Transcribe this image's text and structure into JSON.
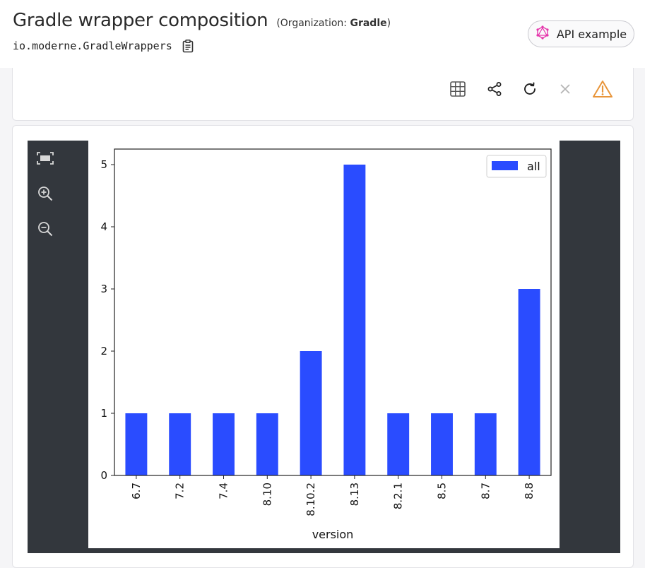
{
  "header": {
    "title": "Gradle wrapper composition",
    "org_prefix": "(Organization: ",
    "org_name": "Gradle",
    "org_suffix": ")",
    "recipe_id": "io.moderne.GradleWrappers",
    "api_button_label": "API example"
  },
  "toolbar": {
    "icons": [
      "table-icon",
      "share-icon",
      "refresh-icon",
      "close-icon",
      "warning-icon"
    ],
    "warning_color": "#e8953a"
  },
  "viewer": {
    "tools": [
      "fit-screen-icon",
      "zoom-in-icon",
      "zoom-out-icon"
    ],
    "background": "#33373d"
  },
  "chart_data": {
    "type": "bar",
    "categories": [
      "6.7",
      "7.2",
      "7.4",
      "8.10",
      "8.10.2",
      "8.13",
      "8.2.1",
      "8.5",
      "8.7",
      "8.8"
    ],
    "series": [
      {
        "name": "all",
        "values": [
          1,
          1,
          1,
          1,
          2,
          5,
          1,
          1,
          1,
          3
        ],
        "color": "#2a4cff"
      }
    ],
    "title": "",
    "xlabel": "version",
    "ylabel": "",
    "ylim": [
      0,
      5.25
    ],
    "yticks": [
      "0",
      "1",
      "2",
      "3",
      "4",
      "5"
    ],
    "legend": "top-right",
    "grid": false
  }
}
